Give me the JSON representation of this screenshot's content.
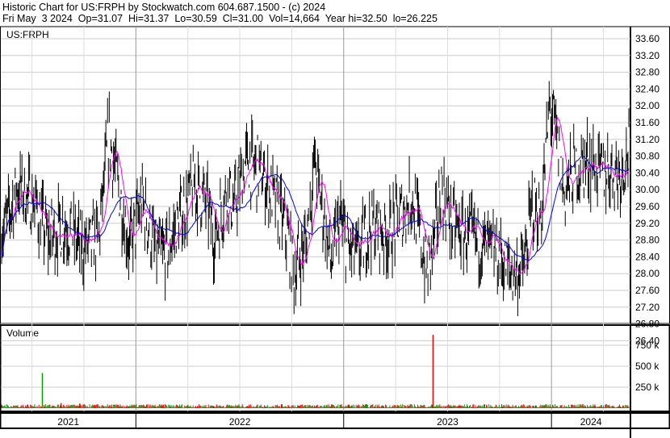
{
  "header": {
    "line1": "Historic Chart for US:FRPH by Stockwatch.com 604.687.1500 - (c) 2024",
    "line2": "Fri May  3 2024  Op=31.07  Hi=31.37  Lo=30.59  Cl=31.00  Vol=14,664  Year hi=32.50  lo=26.225"
  },
  "chart_data": {
    "type": "line",
    "symbol": "US:FRPH",
    "volume_label": "Volume",
    "xlim": [
      2021.35,
      2024.38
    ],
    "ylim": [
      26.0,
      33.9
    ],
    "price_ticks": [
      "33.60",
      "33.20",
      "32.80",
      "32.40",
      "32.00",
      "31.60",
      "31.20",
      "30.80",
      "30.40",
      "30.00",
      "29.60",
      "29.20",
      "28.80",
      "28.40",
      "28.00",
      "27.60",
      "27.20",
      "26.80",
      "26.40"
    ],
    "volume_ticks": [
      {
        "v": 750000,
        "label": "750 k"
      },
      {
        "v": 500000,
        "label": "500 k"
      },
      {
        "v": 250000,
        "label": "250 k"
      }
    ],
    "volume_max": 1050000,
    "years": [
      {
        "label": "2021",
        "start": 2021.35,
        "end": 2022.0
      },
      {
        "label": "2022",
        "start": 2022.0,
        "end": 2023.0
      },
      {
        "label": "2023",
        "start": 2023.0,
        "end": 2024.0
      },
      {
        "label": "2024",
        "start": 2024.0,
        "end": 2024.38
      }
    ],
    "price_series": {
      "t": [
        2021.37,
        2021.43,
        2021.51,
        2021.58,
        2021.66,
        2021.74,
        2021.82,
        2021.87,
        2021.93,
        2021.97,
        2022.03,
        2022.09,
        2022.14,
        2022.2,
        2022.28,
        2022.34,
        2022.38,
        2022.44,
        2022.47,
        2022.53,
        2022.59,
        2022.67,
        2022.73,
        2022.76,
        2022.82,
        2022.86,
        2022.9,
        2022.94,
        2022.98,
        2023.02,
        2023.07,
        2023.13,
        2023.21,
        2023.29,
        2023.33,
        2023.37,
        2023.4,
        2023.44,
        2023.47,
        2023.52,
        2023.58,
        2023.64,
        2023.7,
        2023.75,
        2023.81,
        2023.87,
        2023.91,
        2023.95,
        2023.99,
        2024.02,
        2024.06,
        2024.12,
        2024.18,
        2024.24,
        2024.3,
        2024.33,
        2024.37
      ],
      "close": [
        29.1,
        30.1,
        29.7,
        28.8,
        29.2,
        28.6,
        28.8,
        31.3,
        29.7,
        28.6,
        29.7,
        28.6,
        28.4,
        29.2,
        30.1,
        29.7,
        28.8,
        30.1,
        29.5,
        30.7,
        30.5,
        29.7,
        28.9,
        28.0,
        28.8,
        30.7,
        29.5,
        28.2,
        29.3,
        28.6,
        28.4,
        29.2,
        28.9,
        29.5,
        29.9,
        28.8,
        28.0,
        28.9,
        30.1,
        29.2,
        28.9,
        28.8,
        28.6,
        28.4,
        28.0,
        28.2,
        29.7,
        29.3,
        32.0,
        31.4,
        29.9,
        30.5,
        30.7,
        30.4,
        30.5,
        30.4,
        31.0
      ]
    },
    "volume_spikes": [
      {
        "t": 2021.55,
        "v": 420000
      },
      {
        "t": 2023.43,
        "v": 875000
      },
      {
        "t": 2021.64,
        "v": 60000
      },
      {
        "t": 2021.73,
        "v": 55000
      }
    ],
    "volume_typical": 25000,
    "series": [
      {
        "name": "price",
        "color": "#000000"
      },
      {
        "name": "short MA",
        "color": "#ff00ff"
      },
      {
        "name": "long MA",
        "color": "#0000ff"
      }
    ],
    "volume_colors": {
      "up": "#00a000",
      "down": "#ff0000"
    }
  }
}
